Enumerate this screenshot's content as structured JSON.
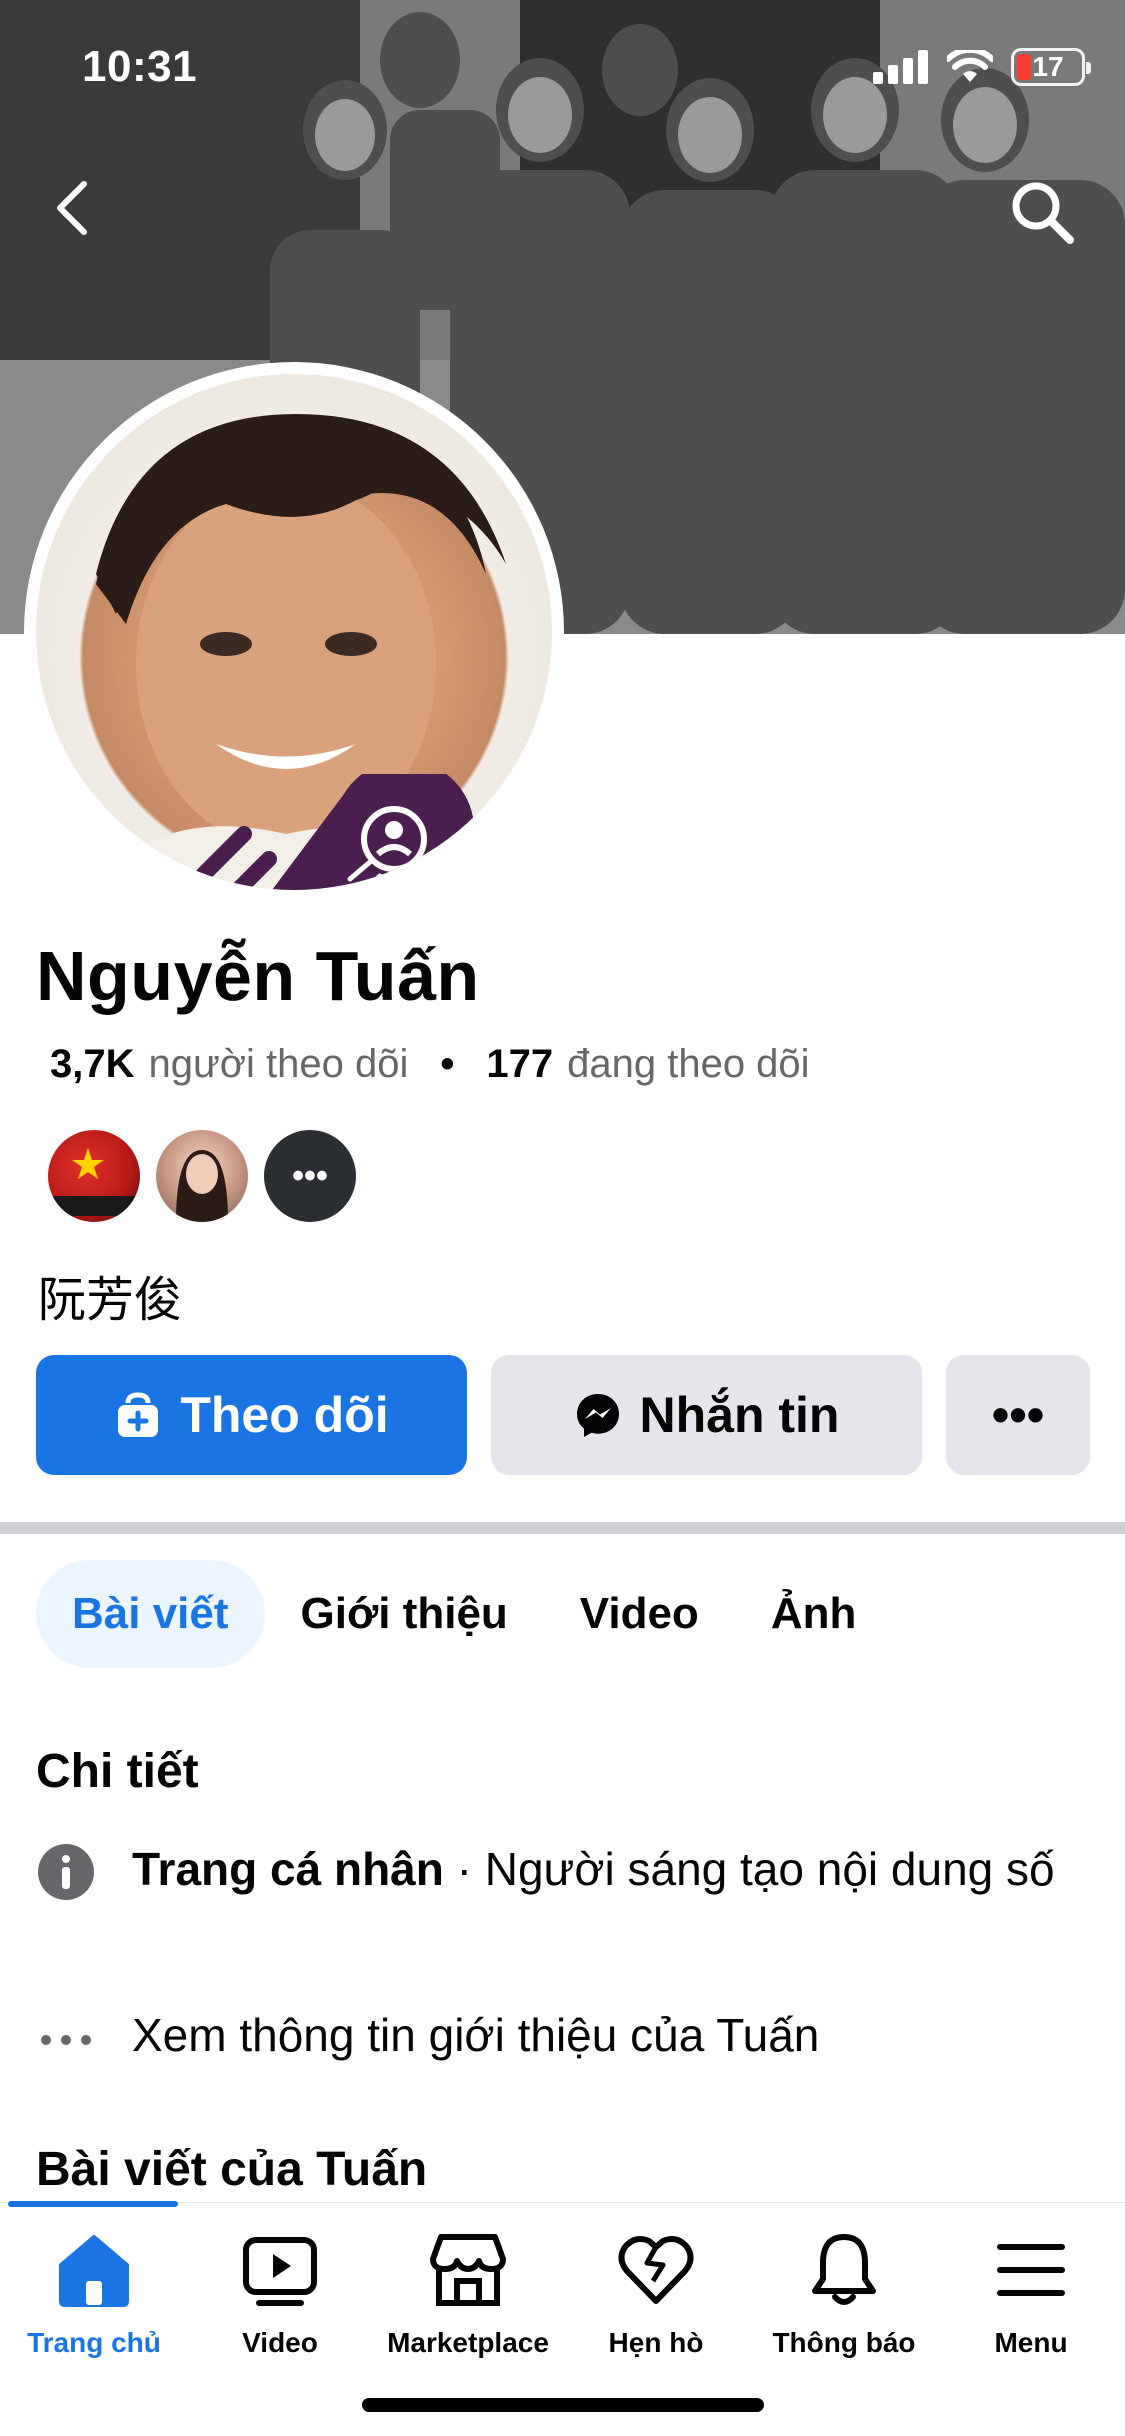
{
  "status_bar": {
    "time": "10:31",
    "battery": "17"
  },
  "profile": {
    "name": "Nguyễn Tuấn",
    "followers_count": "3,7K",
    "followers_label": "người theo dõi",
    "following_count": "177",
    "following_label": "đang theo dõi",
    "friends_more": "•••",
    "bio": "阮芳俊"
  },
  "actions": {
    "follow_label": "Theo dõi",
    "message_label": "Nhắn tin",
    "more_label": "•••"
  },
  "tabs": [
    {
      "label": "Bài viết",
      "active": true
    },
    {
      "label": "Giới thiệu"
    },
    {
      "label": "Video"
    },
    {
      "label": "Ảnh"
    }
  ],
  "details": {
    "title": "Chi tiết",
    "page_type_bold": "Trang cá nhân",
    "page_type_rest": " · Người sáng tạo nội dung số",
    "see_about": "Xem thông tin giới thiệu của Tuấn"
  },
  "posts": {
    "title": "Bài viết của Tuấn"
  },
  "bottom_nav": [
    {
      "label": "Trang chủ",
      "icon": "home-icon",
      "active": true
    },
    {
      "label": "Video",
      "icon": "video-icon"
    },
    {
      "label": "Marketplace",
      "icon": "marketplace-icon"
    },
    {
      "label": "Hẹn hò",
      "icon": "dating-icon"
    },
    {
      "label": "Thông báo",
      "icon": "bell-icon"
    },
    {
      "label": "Menu",
      "icon": "menu-icon"
    }
  ],
  "colors": {
    "accent": "#1b74e4",
    "button_grey": "#e4e6eb",
    "tab_active_bg": "#ebf5ff",
    "badge_purple": "#4a1f4f"
  }
}
